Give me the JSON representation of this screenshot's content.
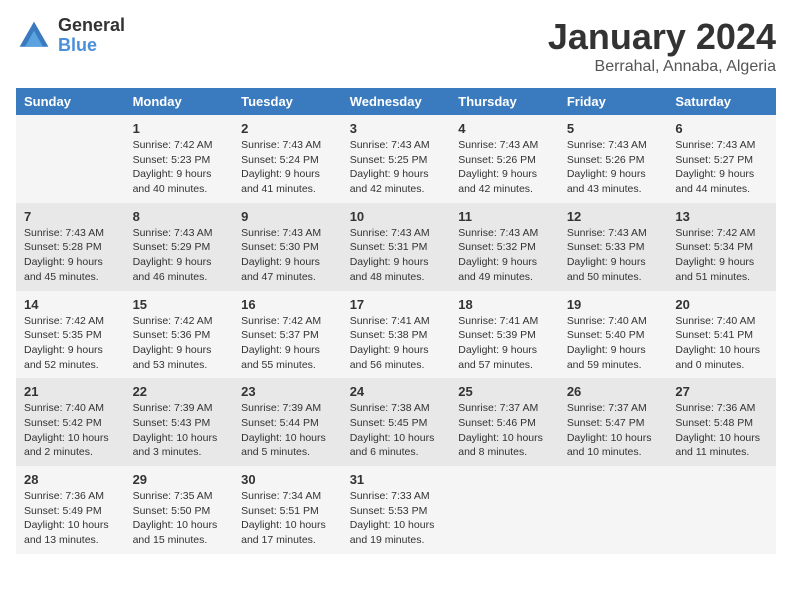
{
  "logo": {
    "general": "General",
    "blue": "Blue"
  },
  "title": "January 2024",
  "subtitle": "Berrahal, Annaba, Algeria",
  "days_of_week": [
    "Sunday",
    "Monday",
    "Tuesday",
    "Wednesday",
    "Thursday",
    "Friday",
    "Saturday"
  ],
  "weeks": [
    [
      {
        "day": "",
        "sunrise": "",
        "sunset": "",
        "daylight": ""
      },
      {
        "day": "1",
        "sunrise": "Sunrise: 7:42 AM",
        "sunset": "Sunset: 5:23 PM",
        "daylight": "Daylight: 9 hours and 40 minutes."
      },
      {
        "day": "2",
        "sunrise": "Sunrise: 7:43 AM",
        "sunset": "Sunset: 5:24 PM",
        "daylight": "Daylight: 9 hours and 41 minutes."
      },
      {
        "day": "3",
        "sunrise": "Sunrise: 7:43 AM",
        "sunset": "Sunset: 5:25 PM",
        "daylight": "Daylight: 9 hours and 42 minutes."
      },
      {
        "day": "4",
        "sunrise": "Sunrise: 7:43 AM",
        "sunset": "Sunset: 5:26 PM",
        "daylight": "Daylight: 9 hours and 42 minutes."
      },
      {
        "day": "5",
        "sunrise": "Sunrise: 7:43 AM",
        "sunset": "Sunset: 5:26 PM",
        "daylight": "Daylight: 9 hours and 43 minutes."
      },
      {
        "day": "6",
        "sunrise": "Sunrise: 7:43 AM",
        "sunset": "Sunset: 5:27 PM",
        "daylight": "Daylight: 9 hours and 44 minutes."
      }
    ],
    [
      {
        "day": "7",
        "sunrise": "Sunrise: 7:43 AM",
        "sunset": "Sunset: 5:28 PM",
        "daylight": "Daylight: 9 hours and 45 minutes."
      },
      {
        "day": "8",
        "sunrise": "Sunrise: 7:43 AM",
        "sunset": "Sunset: 5:29 PM",
        "daylight": "Daylight: 9 hours and 46 minutes."
      },
      {
        "day": "9",
        "sunrise": "Sunrise: 7:43 AM",
        "sunset": "Sunset: 5:30 PM",
        "daylight": "Daylight: 9 hours and 47 minutes."
      },
      {
        "day": "10",
        "sunrise": "Sunrise: 7:43 AM",
        "sunset": "Sunset: 5:31 PM",
        "daylight": "Daylight: 9 hours and 48 minutes."
      },
      {
        "day": "11",
        "sunrise": "Sunrise: 7:43 AM",
        "sunset": "Sunset: 5:32 PM",
        "daylight": "Daylight: 9 hours and 49 minutes."
      },
      {
        "day": "12",
        "sunrise": "Sunrise: 7:43 AM",
        "sunset": "Sunset: 5:33 PM",
        "daylight": "Daylight: 9 hours and 50 minutes."
      },
      {
        "day": "13",
        "sunrise": "Sunrise: 7:42 AM",
        "sunset": "Sunset: 5:34 PM",
        "daylight": "Daylight: 9 hours and 51 minutes."
      }
    ],
    [
      {
        "day": "14",
        "sunrise": "Sunrise: 7:42 AM",
        "sunset": "Sunset: 5:35 PM",
        "daylight": "Daylight: 9 hours and 52 minutes."
      },
      {
        "day": "15",
        "sunrise": "Sunrise: 7:42 AM",
        "sunset": "Sunset: 5:36 PM",
        "daylight": "Daylight: 9 hours and 53 minutes."
      },
      {
        "day": "16",
        "sunrise": "Sunrise: 7:42 AM",
        "sunset": "Sunset: 5:37 PM",
        "daylight": "Daylight: 9 hours and 55 minutes."
      },
      {
        "day": "17",
        "sunrise": "Sunrise: 7:41 AM",
        "sunset": "Sunset: 5:38 PM",
        "daylight": "Daylight: 9 hours and 56 minutes."
      },
      {
        "day": "18",
        "sunrise": "Sunrise: 7:41 AM",
        "sunset": "Sunset: 5:39 PM",
        "daylight": "Daylight: 9 hours and 57 minutes."
      },
      {
        "day": "19",
        "sunrise": "Sunrise: 7:40 AM",
        "sunset": "Sunset: 5:40 PM",
        "daylight": "Daylight: 9 hours and 59 minutes."
      },
      {
        "day": "20",
        "sunrise": "Sunrise: 7:40 AM",
        "sunset": "Sunset: 5:41 PM",
        "daylight": "Daylight: 10 hours and 0 minutes."
      }
    ],
    [
      {
        "day": "21",
        "sunrise": "Sunrise: 7:40 AM",
        "sunset": "Sunset: 5:42 PM",
        "daylight": "Daylight: 10 hours and 2 minutes."
      },
      {
        "day": "22",
        "sunrise": "Sunrise: 7:39 AM",
        "sunset": "Sunset: 5:43 PM",
        "daylight": "Daylight: 10 hours and 3 minutes."
      },
      {
        "day": "23",
        "sunrise": "Sunrise: 7:39 AM",
        "sunset": "Sunset: 5:44 PM",
        "daylight": "Daylight: 10 hours and 5 minutes."
      },
      {
        "day": "24",
        "sunrise": "Sunrise: 7:38 AM",
        "sunset": "Sunset: 5:45 PM",
        "daylight": "Daylight: 10 hours and 6 minutes."
      },
      {
        "day": "25",
        "sunrise": "Sunrise: 7:37 AM",
        "sunset": "Sunset: 5:46 PM",
        "daylight": "Daylight: 10 hours and 8 minutes."
      },
      {
        "day": "26",
        "sunrise": "Sunrise: 7:37 AM",
        "sunset": "Sunset: 5:47 PM",
        "daylight": "Daylight: 10 hours and 10 minutes."
      },
      {
        "day": "27",
        "sunrise": "Sunrise: 7:36 AM",
        "sunset": "Sunset: 5:48 PM",
        "daylight": "Daylight: 10 hours and 11 minutes."
      }
    ],
    [
      {
        "day": "28",
        "sunrise": "Sunrise: 7:36 AM",
        "sunset": "Sunset: 5:49 PM",
        "daylight": "Daylight: 10 hours and 13 minutes."
      },
      {
        "day": "29",
        "sunrise": "Sunrise: 7:35 AM",
        "sunset": "Sunset: 5:50 PM",
        "daylight": "Daylight: 10 hours and 15 minutes."
      },
      {
        "day": "30",
        "sunrise": "Sunrise: 7:34 AM",
        "sunset": "Sunset: 5:51 PM",
        "daylight": "Daylight: 10 hours and 17 minutes."
      },
      {
        "day": "31",
        "sunrise": "Sunrise: 7:33 AM",
        "sunset": "Sunset: 5:53 PM",
        "daylight": "Daylight: 10 hours and 19 minutes."
      },
      {
        "day": "",
        "sunrise": "",
        "sunset": "",
        "daylight": ""
      },
      {
        "day": "",
        "sunrise": "",
        "sunset": "",
        "daylight": ""
      },
      {
        "day": "",
        "sunrise": "",
        "sunset": "",
        "daylight": ""
      }
    ]
  ]
}
